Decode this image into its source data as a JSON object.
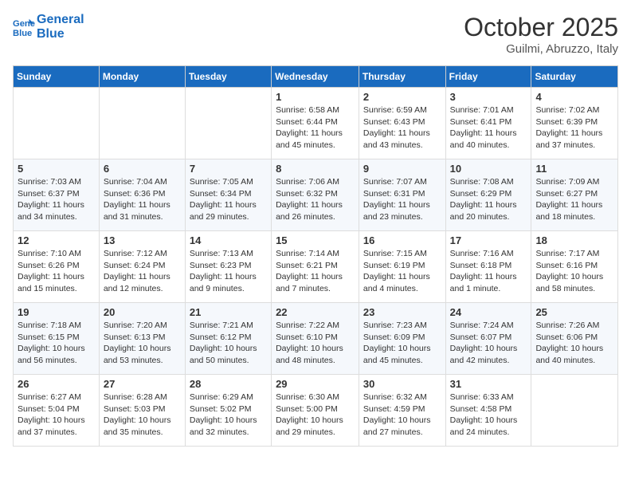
{
  "header": {
    "logo_line1": "General",
    "logo_line2": "Blue",
    "month": "October 2025",
    "location": "Guilmi, Abruzzo, Italy"
  },
  "days_of_week": [
    "Sunday",
    "Monday",
    "Tuesday",
    "Wednesday",
    "Thursday",
    "Friday",
    "Saturday"
  ],
  "weeks": [
    [
      {
        "day": "",
        "info": ""
      },
      {
        "day": "",
        "info": ""
      },
      {
        "day": "",
        "info": ""
      },
      {
        "day": "1",
        "info": "Sunrise: 6:58 AM\nSunset: 6:44 PM\nDaylight: 11 hours and 45 minutes."
      },
      {
        "day": "2",
        "info": "Sunrise: 6:59 AM\nSunset: 6:43 PM\nDaylight: 11 hours and 43 minutes."
      },
      {
        "day": "3",
        "info": "Sunrise: 7:01 AM\nSunset: 6:41 PM\nDaylight: 11 hours and 40 minutes."
      },
      {
        "day": "4",
        "info": "Sunrise: 7:02 AM\nSunset: 6:39 PM\nDaylight: 11 hours and 37 minutes."
      }
    ],
    [
      {
        "day": "5",
        "info": "Sunrise: 7:03 AM\nSunset: 6:37 PM\nDaylight: 11 hours and 34 minutes."
      },
      {
        "day": "6",
        "info": "Sunrise: 7:04 AM\nSunset: 6:36 PM\nDaylight: 11 hours and 31 minutes."
      },
      {
        "day": "7",
        "info": "Sunrise: 7:05 AM\nSunset: 6:34 PM\nDaylight: 11 hours and 29 minutes."
      },
      {
        "day": "8",
        "info": "Sunrise: 7:06 AM\nSunset: 6:32 PM\nDaylight: 11 hours and 26 minutes."
      },
      {
        "day": "9",
        "info": "Sunrise: 7:07 AM\nSunset: 6:31 PM\nDaylight: 11 hours and 23 minutes."
      },
      {
        "day": "10",
        "info": "Sunrise: 7:08 AM\nSunset: 6:29 PM\nDaylight: 11 hours and 20 minutes."
      },
      {
        "day": "11",
        "info": "Sunrise: 7:09 AM\nSunset: 6:27 PM\nDaylight: 11 hours and 18 minutes."
      }
    ],
    [
      {
        "day": "12",
        "info": "Sunrise: 7:10 AM\nSunset: 6:26 PM\nDaylight: 11 hours and 15 minutes."
      },
      {
        "day": "13",
        "info": "Sunrise: 7:12 AM\nSunset: 6:24 PM\nDaylight: 11 hours and 12 minutes."
      },
      {
        "day": "14",
        "info": "Sunrise: 7:13 AM\nSunset: 6:23 PM\nDaylight: 11 hours and 9 minutes."
      },
      {
        "day": "15",
        "info": "Sunrise: 7:14 AM\nSunset: 6:21 PM\nDaylight: 11 hours and 7 minutes."
      },
      {
        "day": "16",
        "info": "Sunrise: 7:15 AM\nSunset: 6:19 PM\nDaylight: 11 hours and 4 minutes."
      },
      {
        "day": "17",
        "info": "Sunrise: 7:16 AM\nSunset: 6:18 PM\nDaylight: 11 hours and 1 minute."
      },
      {
        "day": "18",
        "info": "Sunrise: 7:17 AM\nSunset: 6:16 PM\nDaylight: 10 hours and 58 minutes."
      }
    ],
    [
      {
        "day": "19",
        "info": "Sunrise: 7:18 AM\nSunset: 6:15 PM\nDaylight: 10 hours and 56 minutes."
      },
      {
        "day": "20",
        "info": "Sunrise: 7:20 AM\nSunset: 6:13 PM\nDaylight: 10 hours and 53 minutes."
      },
      {
        "day": "21",
        "info": "Sunrise: 7:21 AM\nSunset: 6:12 PM\nDaylight: 10 hours and 50 minutes."
      },
      {
        "day": "22",
        "info": "Sunrise: 7:22 AM\nSunset: 6:10 PM\nDaylight: 10 hours and 48 minutes."
      },
      {
        "day": "23",
        "info": "Sunrise: 7:23 AM\nSunset: 6:09 PM\nDaylight: 10 hours and 45 minutes."
      },
      {
        "day": "24",
        "info": "Sunrise: 7:24 AM\nSunset: 6:07 PM\nDaylight: 10 hours and 42 minutes."
      },
      {
        "day": "25",
        "info": "Sunrise: 7:26 AM\nSunset: 6:06 PM\nDaylight: 10 hours and 40 minutes."
      }
    ],
    [
      {
        "day": "26",
        "info": "Sunrise: 6:27 AM\nSunset: 5:04 PM\nDaylight: 10 hours and 37 minutes."
      },
      {
        "day": "27",
        "info": "Sunrise: 6:28 AM\nSunset: 5:03 PM\nDaylight: 10 hours and 35 minutes."
      },
      {
        "day": "28",
        "info": "Sunrise: 6:29 AM\nSunset: 5:02 PM\nDaylight: 10 hours and 32 minutes."
      },
      {
        "day": "29",
        "info": "Sunrise: 6:30 AM\nSunset: 5:00 PM\nDaylight: 10 hours and 29 minutes."
      },
      {
        "day": "30",
        "info": "Sunrise: 6:32 AM\nSunset: 4:59 PM\nDaylight: 10 hours and 27 minutes."
      },
      {
        "day": "31",
        "info": "Sunrise: 6:33 AM\nSunset: 4:58 PM\nDaylight: 10 hours and 24 minutes."
      },
      {
        "day": "",
        "info": ""
      }
    ]
  ]
}
